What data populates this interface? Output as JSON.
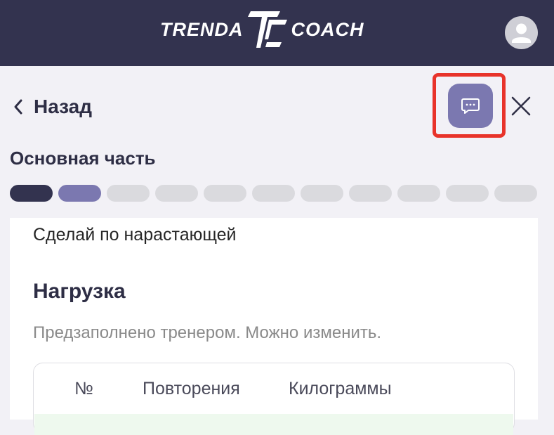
{
  "header": {
    "logo_left": "TRENDA",
    "logo_right": "COACH"
  },
  "nav": {
    "back_label": "Назад"
  },
  "section": {
    "title": "Основная часть",
    "progress": {
      "total": 11,
      "completed": 1,
      "current": 2
    }
  },
  "exercise": {
    "instruction": "Сделай по нарастающей",
    "load_title": "Нагрузка",
    "load_hint": "Предзаполнено тренером. Можно изменить.",
    "table_headers": [
      "№",
      "Повторения",
      "Килограммы"
    ]
  },
  "colors": {
    "header_bg": "#33334f",
    "accent": "#7b78b0",
    "highlight": "#e8332a"
  },
  "icons": {
    "back": "chevron-left-icon",
    "chat": "chat-bubble-icon",
    "close": "close-icon",
    "avatar": "user-icon"
  }
}
